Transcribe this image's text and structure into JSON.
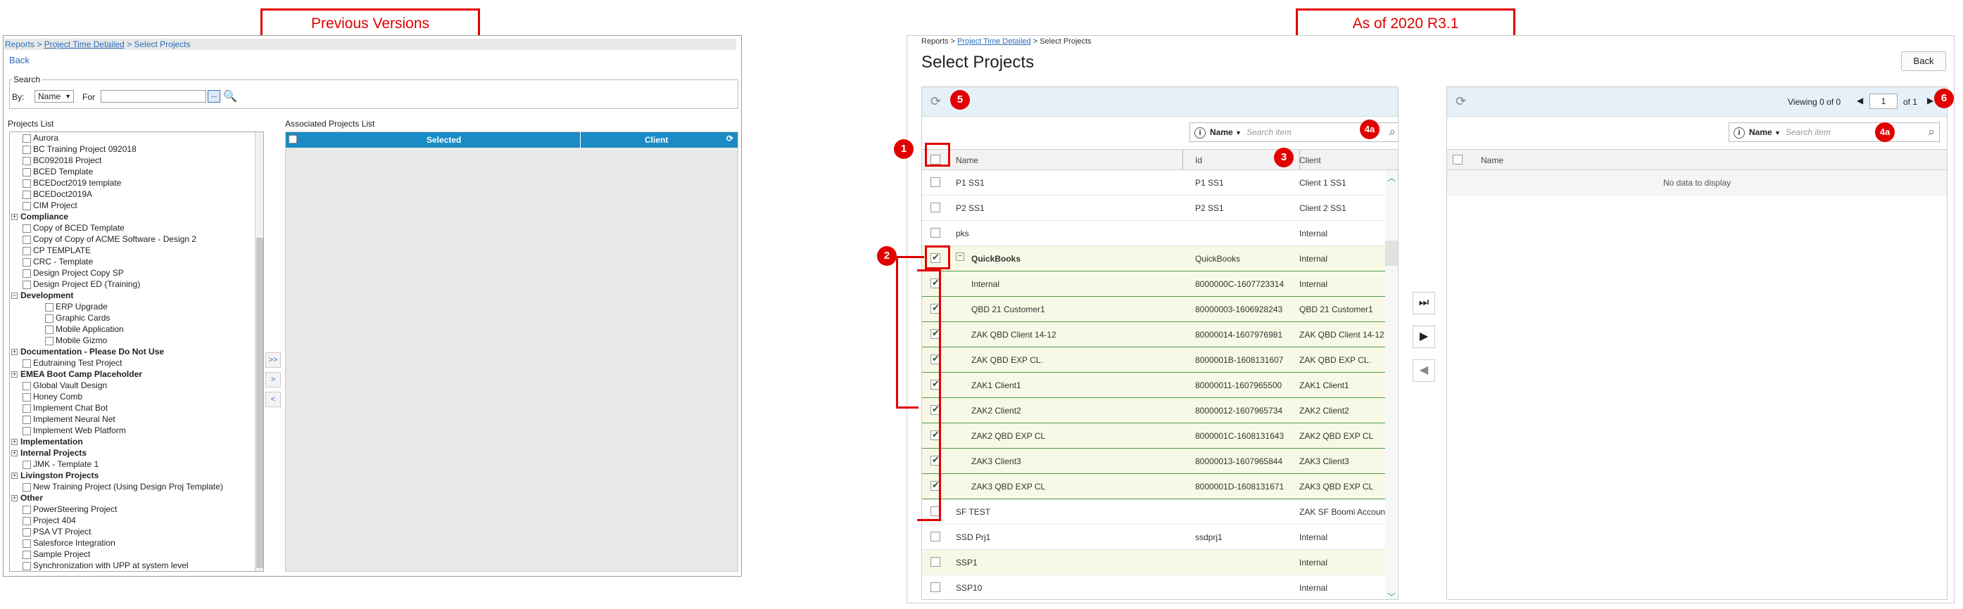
{
  "callouts": {
    "previous": "Previous Versions",
    "current": "As of 2020 R3.1"
  },
  "badges": [
    "1",
    "2",
    "3",
    "4a",
    "4a",
    "5",
    "6"
  ],
  "old": {
    "breadcrumb": {
      "reports": "Reports",
      "sep1": ">",
      "detailed": "Project Time Detailed",
      "sep2": ">",
      "current": "Select Projects"
    },
    "back": "Back",
    "search_legend": "Search",
    "by_label": "By:",
    "by_value": "Name",
    "for_label": "For",
    "dots": "...",
    "projects_list_label": "Projects List",
    "associated_label": "Associated Projects List",
    "assoc_headers": [
      "Selected",
      "Client"
    ],
    "mid_buttons": [
      ">>",
      ">",
      "<"
    ],
    "tree": [
      {
        "label": "Aurora",
        "level": 1
      },
      {
        "label": "BC Training Project 092018",
        "level": 1
      },
      {
        "label": "BC092018 Project",
        "level": 1
      },
      {
        "label": "BCED Template",
        "level": 1
      },
      {
        "label": "BCEDoct2019 template",
        "level": 1
      },
      {
        "label": "BCEDoct2019A",
        "level": 1
      },
      {
        "label": "CIM Project",
        "level": 1
      },
      {
        "label": "Compliance",
        "level": 0,
        "sign": "+"
      },
      {
        "label": "Copy of BCED Template",
        "level": 1
      },
      {
        "label": "Copy of Copy of ACME Software - Design 2",
        "level": 1
      },
      {
        "label": "CP TEMPLATE",
        "level": 1
      },
      {
        "label": "CRC - Template",
        "level": 1
      },
      {
        "label": "Design Project Copy SP",
        "level": 1
      },
      {
        "label": "Design Project ED (Training)",
        "level": 1
      },
      {
        "label": "Development",
        "level": 0,
        "sign": "−"
      },
      {
        "label": "ERP Upgrade",
        "level": 2
      },
      {
        "label": "Graphic Cards",
        "level": 2
      },
      {
        "label": "Mobile Application",
        "level": 2
      },
      {
        "label": "Mobile Gizmo",
        "level": 2
      },
      {
        "label": "Documentation - Please Do Not Use",
        "level": 0,
        "sign": "+"
      },
      {
        "label": "Edutraining Test Project",
        "level": 1
      },
      {
        "label": "EMEA Boot Camp Placeholder",
        "level": 0,
        "sign": "+"
      },
      {
        "label": "Global Vault Design",
        "level": 1
      },
      {
        "label": "Honey Comb",
        "level": 1
      },
      {
        "label": "Implement Chat Bot",
        "level": 1
      },
      {
        "label": "Implement Neural Net",
        "level": 1
      },
      {
        "label": "Implement Web Platform",
        "level": 1
      },
      {
        "label": "Implementation",
        "level": 0,
        "sign": "+"
      },
      {
        "label": "Internal Projects",
        "level": 0,
        "sign": "+"
      },
      {
        "label": "JMK - Template 1",
        "level": 1
      },
      {
        "label": "Livingston Projects",
        "level": 0,
        "sign": "+"
      },
      {
        "label": "New Training Project (Using Design Proj Template)",
        "level": 1
      },
      {
        "label": "Other",
        "level": 0,
        "sign": "+"
      },
      {
        "label": "PowerSteering Project",
        "level": 1
      },
      {
        "label": "Project 404",
        "level": 1
      },
      {
        "label": "PSA VT Project",
        "level": 1
      },
      {
        "label": "Salesforce Integration",
        "level": 1
      },
      {
        "label": "Sample Project",
        "level": 1
      },
      {
        "label": "Synchronization with UPP at system level",
        "level": 1
      }
    ]
  },
  "new": {
    "breadcrumb": {
      "reports": "Reports",
      "sep1": ">",
      "detailed": "Project Time Detailed",
      "sep2": ">",
      "current": "Select Projects"
    },
    "title": "Select Projects",
    "back": "Back",
    "left": {
      "search_by": "Name",
      "search_placeholder": "Search item",
      "columns": [
        "Name",
        "Id",
        "Client"
      ],
      "rows": [
        {
          "name": "P1 SS1",
          "id": "P1 SS1",
          "client": "Client 1 SS1",
          "checked": false,
          "style": ""
        },
        {
          "name": "P2 SS1",
          "id": "P2 SS1",
          "client": "Client 2 SS1",
          "checked": false,
          "style": ""
        },
        {
          "name": "pks",
          "id": "",
          "client": "Internal",
          "checked": false,
          "style": ""
        },
        {
          "name": "QuickBooks",
          "id": "QuickBooks",
          "client": "Internal",
          "checked": true,
          "style": "parent"
        },
        {
          "name": "Internal",
          "id": "8000000C-1607723314",
          "client": "Internal",
          "checked": true,
          "style": "child"
        },
        {
          "name": "QBD 21 Customer1",
          "id": "80000003-1606928243",
          "client": "QBD 21 Customer1",
          "checked": true,
          "style": "child"
        },
        {
          "name": "ZAK QBD Client 14-12",
          "id": "80000014-1607976981",
          "client": "ZAK QBD Client 14-12",
          "checked": true,
          "style": "child"
        },
        {
          "name": "ZAK QBD EXP CL.",
          "id": "8000001B-1608131607",
          "client": "ZAK QBD EXP CL.",
          "checked": true,
          "style": "child"
        },
        {
          "name": "ZAK1 Client1",
          "id": "80000011-1607965500",
          "client": "ZAK1 Client1",
          "checked": true,
          "style": "child"
        },
        {
          "name": "ZAK2 Client2",
          "id": "80000012-1607965734",
          "client": "ZAK2 Client2",
          "checked": true,
          "style": "child"
        },
        {
          "name": "ZAK2 QBD EXP CL",
          "id": "8000001C-1608131643",
          "client": "ZAK2 QBD EXP CL",
          "checked": true,
          "style": "child"
        },
        {
          "name": "ZAK3 Client3",
          "id": "80000013-1607965844",
          "client": "ZAK3 Client3",
          "checked": true,
          "style": "child"
        },
        {
          "name": "ZAK3 QBD EXP CL",
          "id": "8000001D-1608131671",
          "client": "ZAK3 QBD EXP CL",
          "checked": true,
          "style": "child"
        },
        {
          "name": "SF TEST",
          "id": "",
          "client": "ZAK SF Boomi Account",
          "checked": false,
          "style": ""
        },
        {
          "name": "SSD Prj1",
          "id": "ssdprj1",
          "client": "Internal",
          "checked": false,
          "style": ""
        },
        {
          "name": "SSP1",
          "id": "",
          "client": "Internal",
          "checked": false,
          "style": "y"
        },
        {
          "name": "SSP10",
          "id": "",
          "client": "Internal",
          "checked": false,
          "style": ""
        }
      ]
    },
    "right": {
      "viewing": "Viewing 0 of 0",
      "page": "1",
      "of_pages": "of 1",
      "search_by": "Name",
      "search_placeholder": "Search item",
      "column": "Name",
      "empty": "No data to display"
    },
    "transfer_buttons": [
      "⏭",
      "▶",
      "◀"
    ]
  }
}
